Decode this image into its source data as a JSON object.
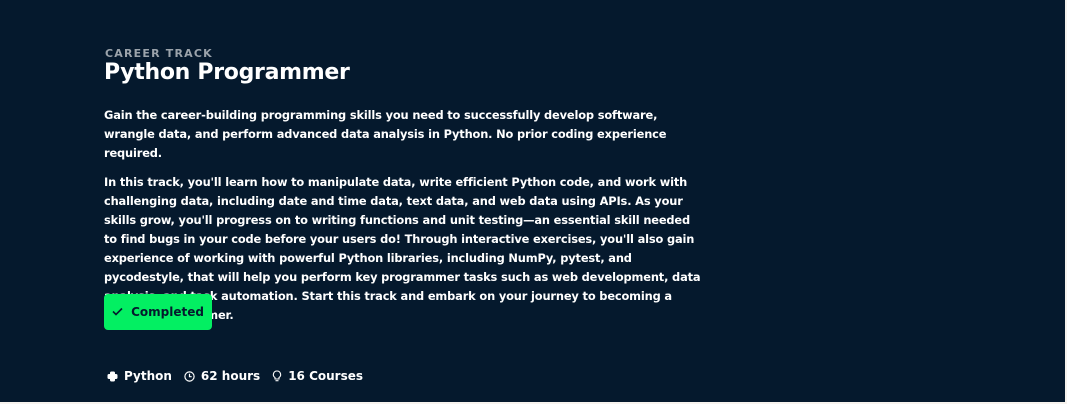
{
  "eyebrow": "CAREER TRACK",
  "title": "Python Programmer",
  "description": [
    "Gain the career-building programming skills you need to successfully develop software, wrangle data, and perform advanced data analysis in Python. No prior coding experience required.",
    "In this track, you'll learn how to manipulate data, write efficient Python code, and work with challenging data, including date and time data, text data, and web data using APIs. As your skills grow, you'll progress on to writing functions and unit testing—an essential skill needed to find bugs in your code before your users do! Through interactive exercises, you'll also gain experience of working with powerful Python libraries, including NumPy, pytest, and pycodestyle, that will help you perform key programmer tasks such as web development, data analysis, and task automation. Start this track and embark on your journey to becoming a Python programmer."
  ],
  "status_button": {
    "label": "Completed",
    "icon": "check-icon",
    "color": "#03ef62"
  },
  "meta": {
    "technology": "Python",
    "duration": "62 hours",
    "courses": "16 Courses"
  },
  "colors": {
    "background": "#05192d",
    "accent": "#03ef62"
  }
}
